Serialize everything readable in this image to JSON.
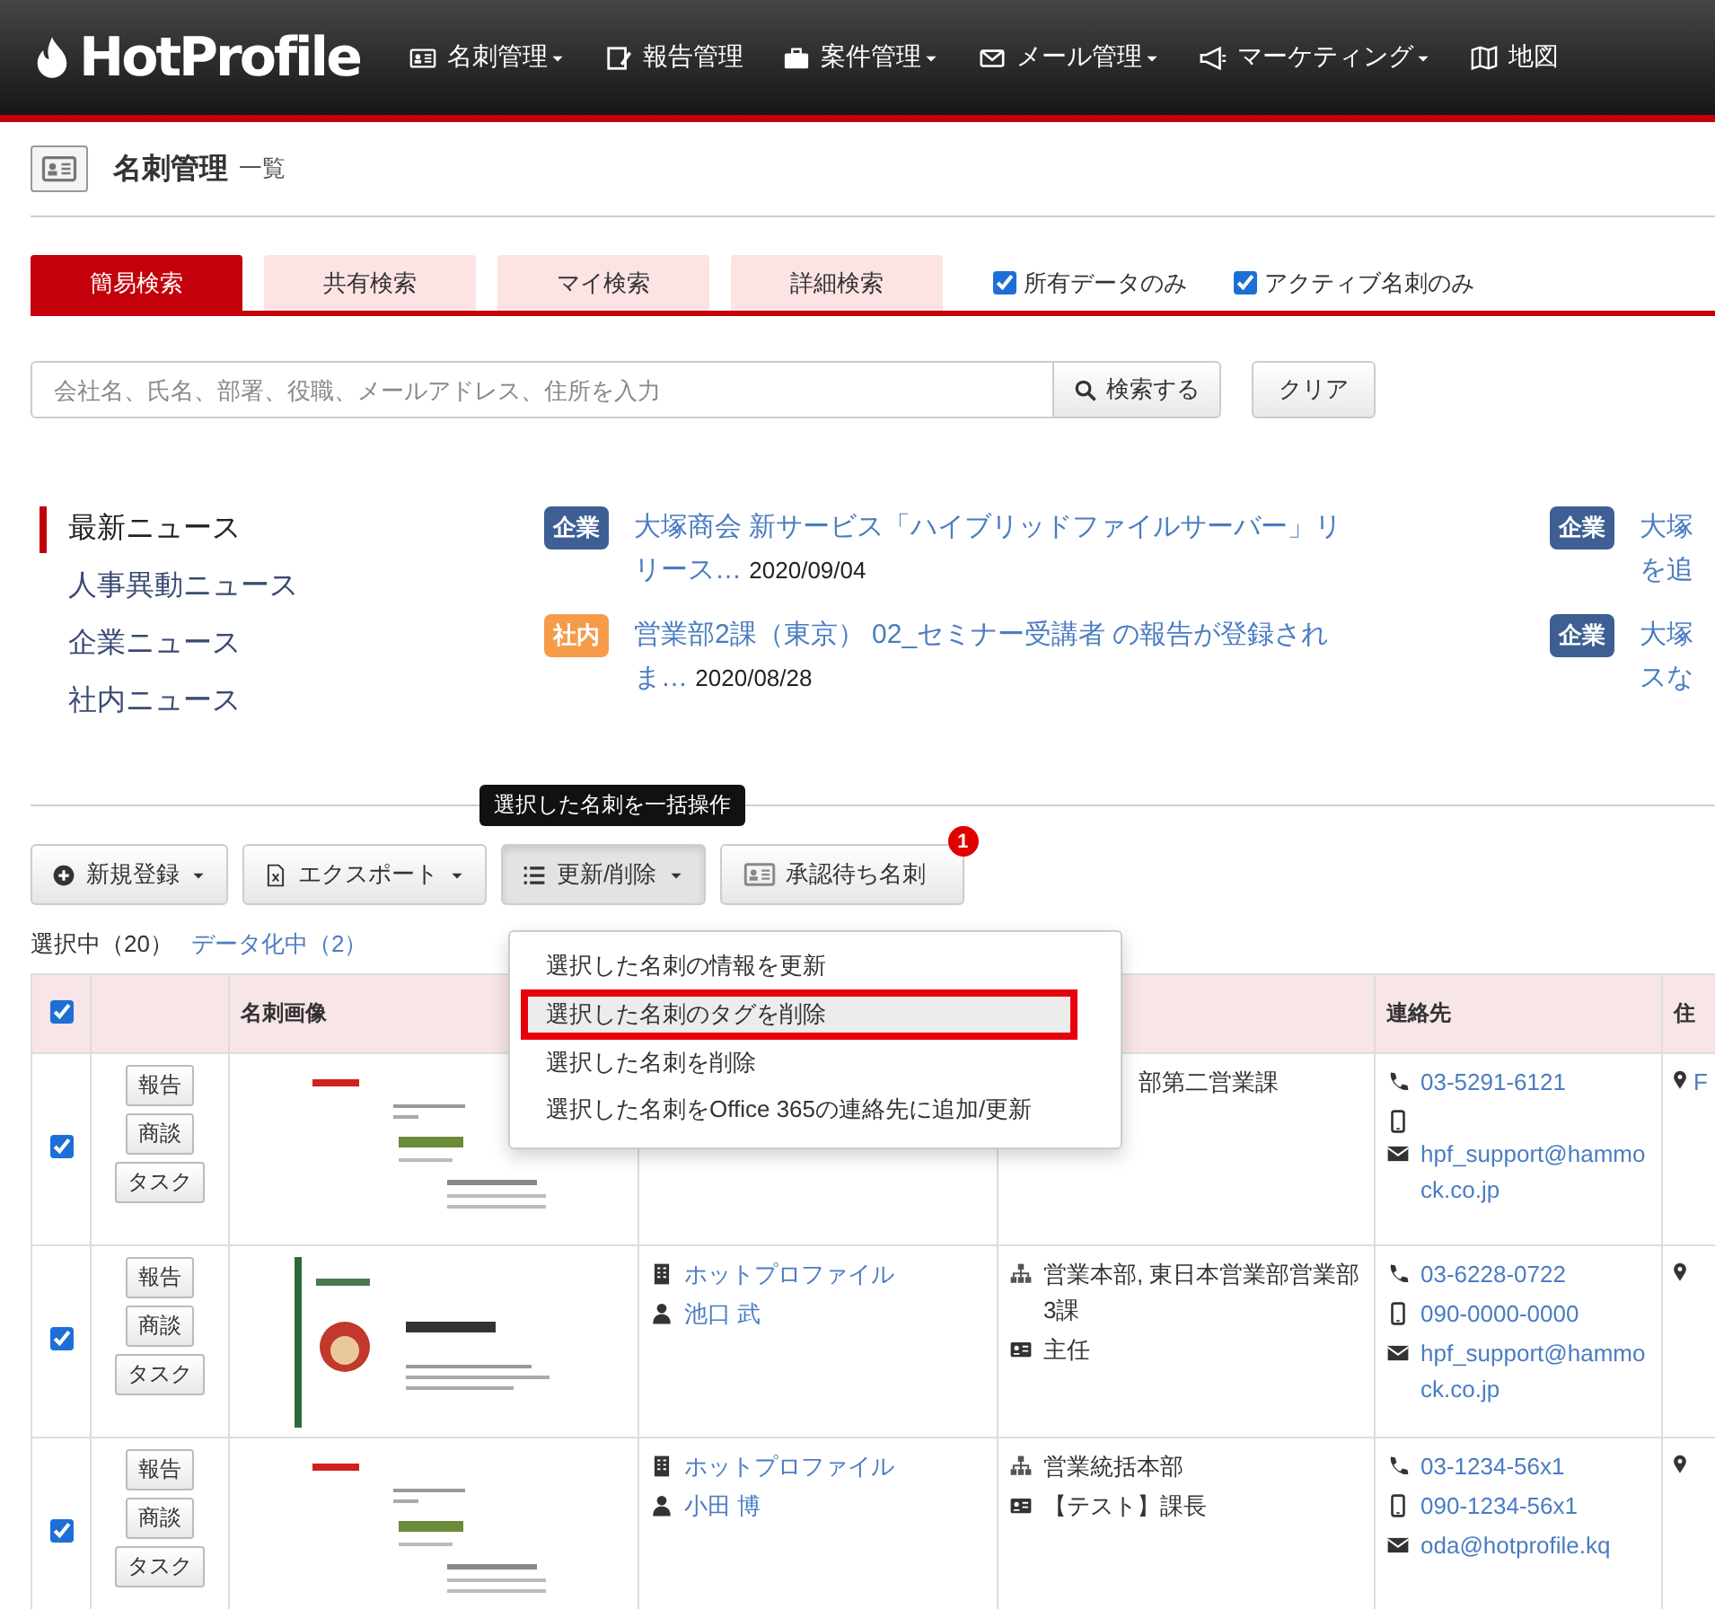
{
  "nav": {
    "logo": "HotProfile",
    "items": [
      {
        "label": "名刺管理",
        "dropdown": true
      },
      {
        "label": "報告管理",
        "dropdown": false
      },
      {
        "label": "案件管理",
        "dropdown": true
      },
      {
        "label": "メール管理",
        "dropdown": true
      },
      {
        "label": "マーケティング",
        "dropdown": true
      },
      {
        "label": "地図",
        "dropdown": false
      }
    ]
  },
  "page_title": {
    "title": "名刺管理",
    "subtitle": "一覧"
  },
  "search_tabs": [
    {
      "label": "簡易検索",
      "selected": true
    },
    {
      "label": "共有検索",
      "selected": false
    },
    {
      "label": "マイ検索",
      "selected": false
    },
    {
      "label": "詳細検索",
      "selected": false
    }
  ],
  "filters": [
    {
      "label": "所有データのみ",
      "checked": true
    },
    {
      "label": "アクティブ名刺のみ",
      "checked": true
    }
  ],
  "search": {
    "placeholder": "会社名、氏名、部署、役職、メールアドレス、住所を入力",
    "button": "検索する",
    "clear": "クリア"
  },
  "news_categories": [
    {
      "label": "最新ニュース",
      "selected": true
    },
    {
      "label": "人事異動ニュース",
      "selected": false
    },
    {
      "label": "企業ニュース",
      "selected": false
    },
    {
      "label": "社内ニュース",
      "selected": false
    }
  ],
  "news": [
    {
      "tag": "企業",
      "color": "#3d5f93",
      "title": "大塚商会 新サービス「ハイブリッドファイルサーバー」リリース…",
      "date": "2020/09/04"
    },
    {
      "tag": "社内",
      "color": "#f59b4a",
      "title": "営業部2課（東京） 02_セミナー受講者 の報告が登録されま…",
      "date": "2020/08/28"
    }
  ],
  "news_cut": [
    {
      "tag": "企業",
      "color": "#3d5f93",
      "lines": [
        "大塚",
        "を追"
      ]
    },
    {
      "tag": "企業",
      "color": "#3d5f93",
      "lines": [
        "大塚",
        "スな"
      ]
    }
  ],
  "bulk_tooltip": "選択した名刺を一括操作",
  "toolbar": [
    {
      "label": "新規登録",
      "dropdown": true,
      "pressed": false
    },
    {
      "label": "エクスポート",
      "dropdown": true,
      "pressed": false
    },
    {
      "label": "更新/削除",
      "dropdown": true,
      "pressed": true
    },
    {
      "label": "承認待ち名刺",
      "dropdown": false,
      "pressed": false,
      "badge": "1"
    }
  ],
  "selection": {
    "selected": "選択中（20）",
    "digitizing": "データ化中（2）"
  },
  "menu": [
    {
      "label": "選択した名刺の情報を更新",
      "highlighted": false
    },
    {
      "label": "選択した名刺のタグを削除",
      "highlighted": true
    },
    {
      "label": "選択した名刺を削除",
      "highlighted": false
    },
    {
      "label": "選択した名刺をOffice 365の連絡先に追加/更新",
      "highlighted": false
    }
  ],
  "table": {
    "header": {
      "checked": true,
      "card_image": "名刺画像",
      "contact": "連絡先",
      "address": "住"
    },
    "rows": [
      {
        "checked": true,
        "actions": [
          "報告",
          "商談",
          "タスク"
        ],
        "card": {
          "kind": "picture"
        },
        "department": "部第二営業課",
        "phone": "03-5291-6121",
        "email": "hpf_support@hammock.co.jp",
        "address": "F"
      },
      {
        "checked": true,
        "actions": [
          "報告",
          "商談",
          "タスク"
        ],
        "card": {
          "kind": "picture"
        },
        "company": "ホットプロファイル",
        "person": "池口 武",
        "department": "営業本部, 東日本営業部営業部3課",
        "title": "主任",
        "phone": "03-6228-0722",
        "mobile": "090-0000-0000",
        "email": "hpf_support@hammock.co.jp"
      },
      {
        "checked": true,
        "actions": [
          "報告",
          "商談",
          "タスク"
        ],
        "card": {
          "kind": "picture"
        },
        "company": "ホットプロファイル",
        "person": "小田 博",
        "department": "営業統括本部",
        "title": "【テスト】課長",
        "phone": "03-1234-56x1",
        "mobile": "090-1234-56x1",
        "email": "oda@hotprofile.kq"
      }
    ]
  }
}
